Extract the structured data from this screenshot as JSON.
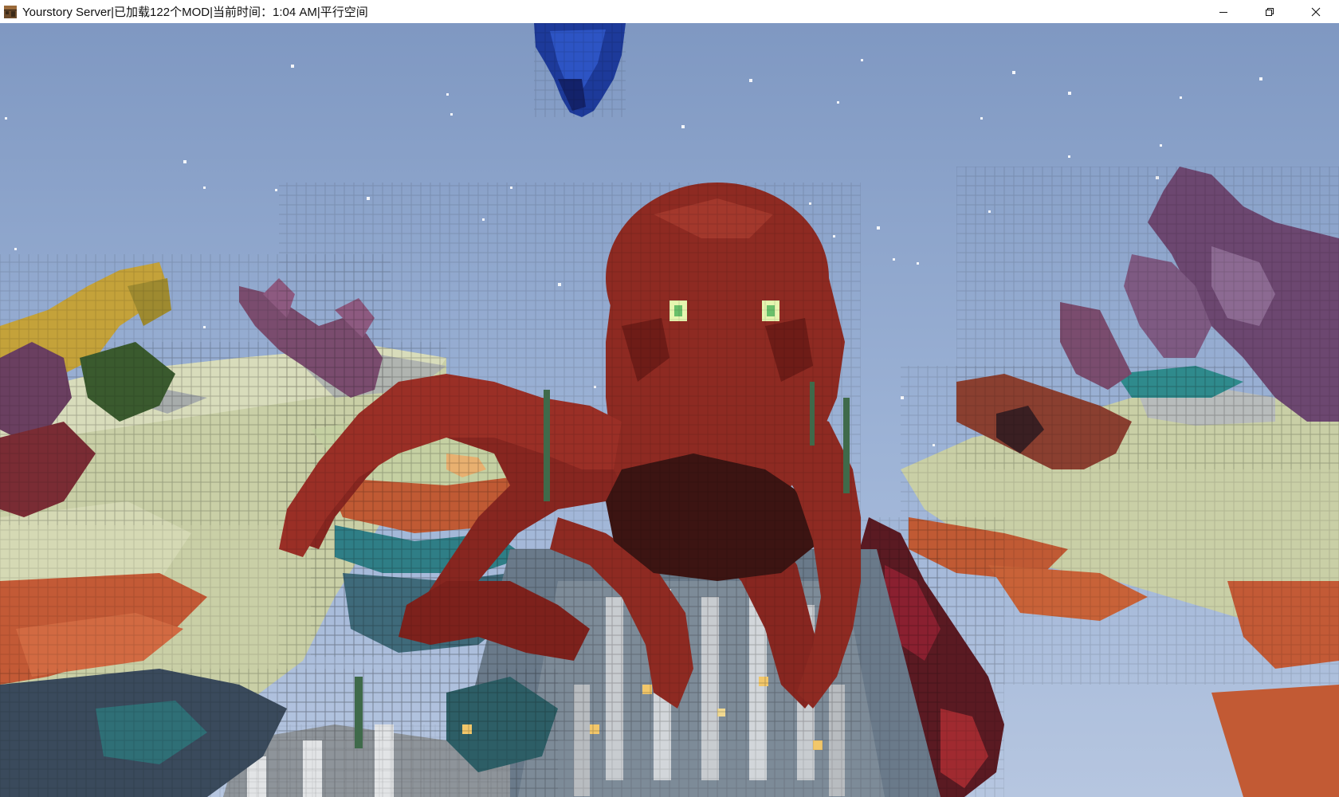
{
  "window": {
    "title": "Yourstory Server|已加载122个MOD|当前时间：1:04 AM|平行空间",
    "app_icon": "crafting-table-icon",
    "controls": {
      "minimize_icon": "minimize-icon",
      "maximize_icon": "restore-icon",
      "close_icon": "close-icon"
    }
  },
  "scene": {
    "description_icon": "game-viewport",
    "colors": {
      "sky": "#8fa6cc",
      "octopus": "#8e2a22",
      "octopus_dark": "#5a1712",
      "coral_sand": "#c9cfa6",
      "coral_orange": "#c25a34",
      "coral_purple": "#7a4c6e",
      "coral_teal": "#2f7e86",
      "stone": "#9aa0a8",
      "eye_glow": "#e6f6b0"
    }
  }
}
